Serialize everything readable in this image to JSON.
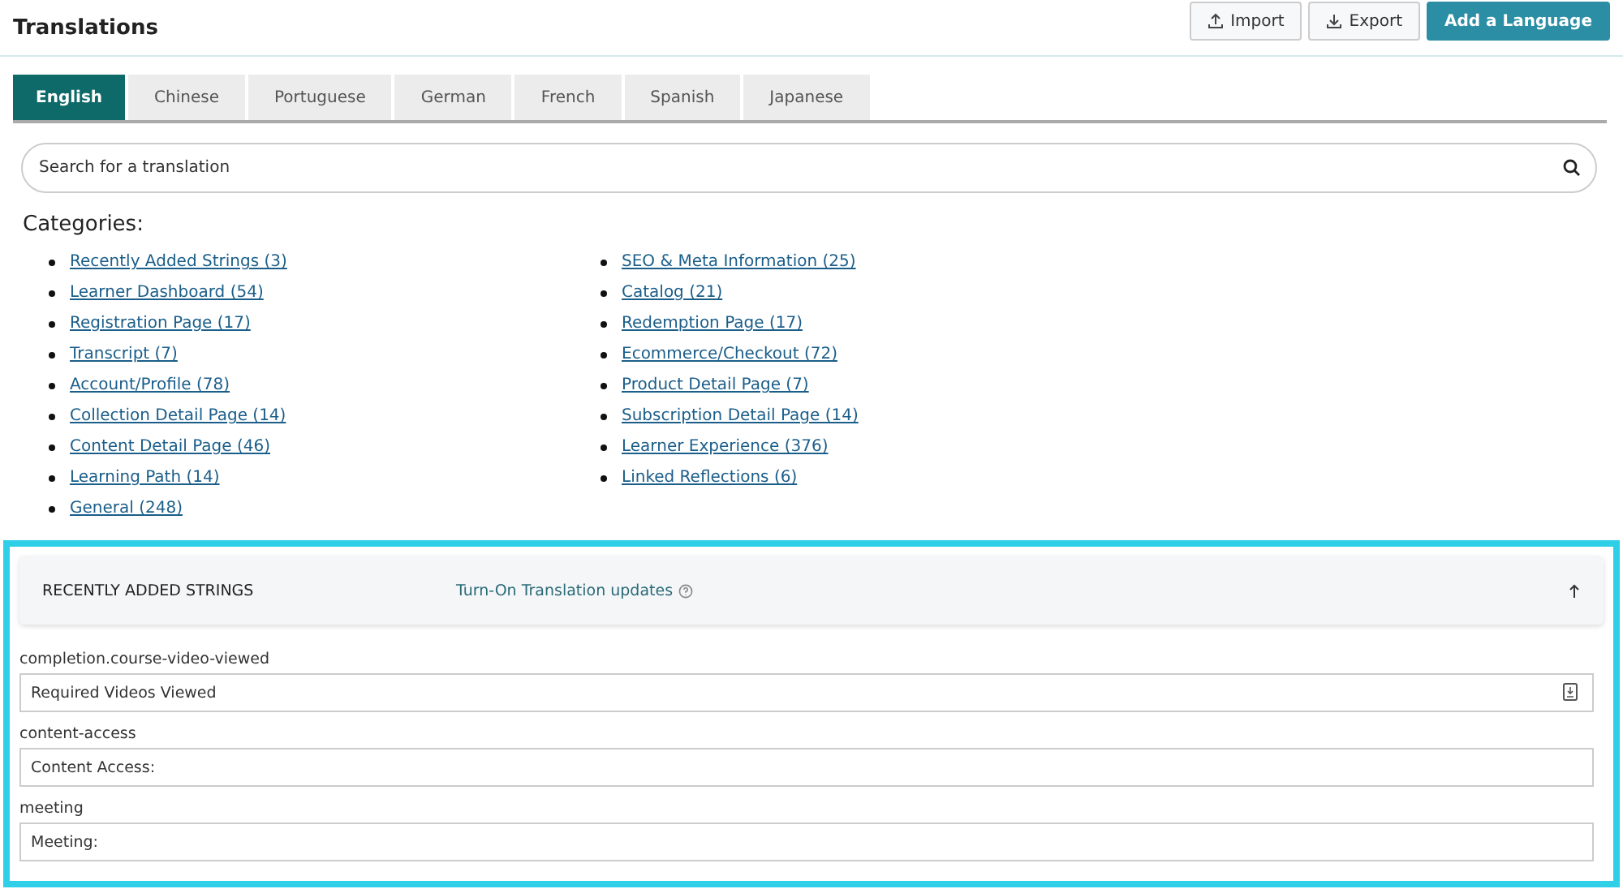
{
  "header": {
    "title": "Translations",
    "buttons": [
      {
        "label": "Import",
        "kind": "upload"
      },
      {
        "label": "Export",
        "kind": "download"
      },
      {
        "label": "Add a Language",
        "kind": "primary"
      }
    ]
  },
  "tabs": [
    {
      "label": "English",
      "selected": true
    },
    {
      "label": "Chinese",
      "selected": false
    },
    {
      "label": "Portuguese",
      "selected": false
    },
    {
      "label": "German",
      "selected": false
    },
    {
      "label": "French",
      "selected": false
    },
    {
      "label": "Spanish",
      "selected": false
    },
    {
      "label": "Japanese",
      "selected": false
    }
  ],
  "search": {
    "placeholder": "Search for a translation"
  },
  "categories": {
    "title": "Categories:",
    "columns": [
      [
        "Recently Added Strings (3)",
        "Learner Dashboard (54)",
        "Registration Page (17)",
        "Transcript (7)",
        "Account/Profile (78)",
        "Collection Detail Page (14)",
        "Content Detail Page (46)",
        "Learning Path (14)",
        "General (248)"
      ],
      [
        "SEO & Meta Information (25)",
        "Catalog (21)",
        "Redemption Page (17)",
        "Ecommerce/Checkout (72)",
        "Product Detail Page (7)",
        "Subscription Detail Page (14)",
        "Learner Experience (376)",
        "Linked Reflections (6)"
      ]
    ]
  },
  "section": {
    "title": "RECENTLY ADDED STRINGS",
    "link": "Turn-On Translation updates",
    "expanded": true,
    "highlighted": true,
    "fields": [
      {
        "key": "completion.course-video-viewed",
        "value": "Required Videos Viewed",
        "kind": "with-icon"
      },
      {
        "key": "content-access",
        "value": "Content Access:",
        "kind": "plain"
      },
      {
        "key": "meeting",
        "value": "Meeting:",
        "kind": "plain"
      }
    ]
  }
}
